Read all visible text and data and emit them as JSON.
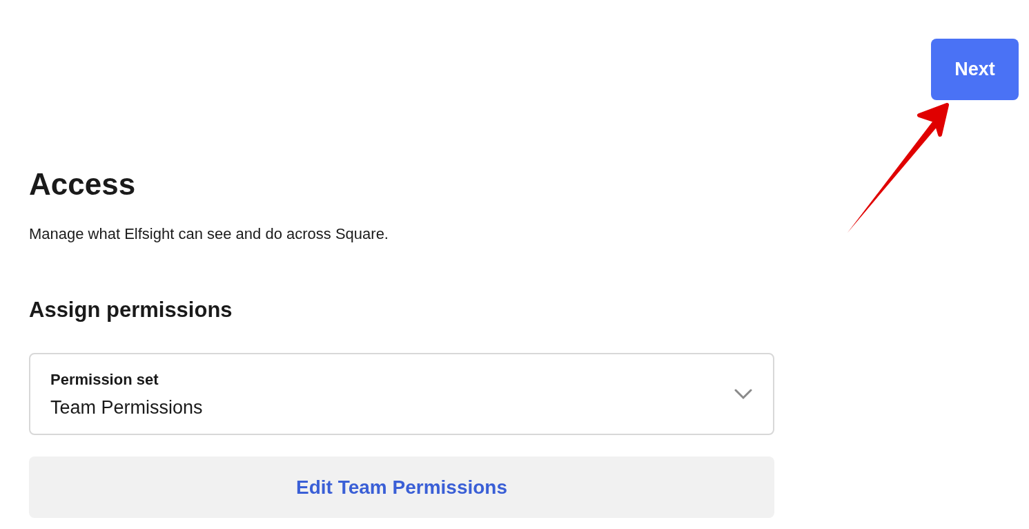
{
  "header": {
    "next_button": "Next"
  },
  "access": {
    "title": "Access",
    "description": "Manage what Elfsight can see and do across Square."
  },
  "assign": {
    "title": "Assign permissions",
    "select": {
      "label": "Permission set",
      "value": "Team Permissions"
    },
    "edit_button": "Edit Team Permissions"
  }
}
